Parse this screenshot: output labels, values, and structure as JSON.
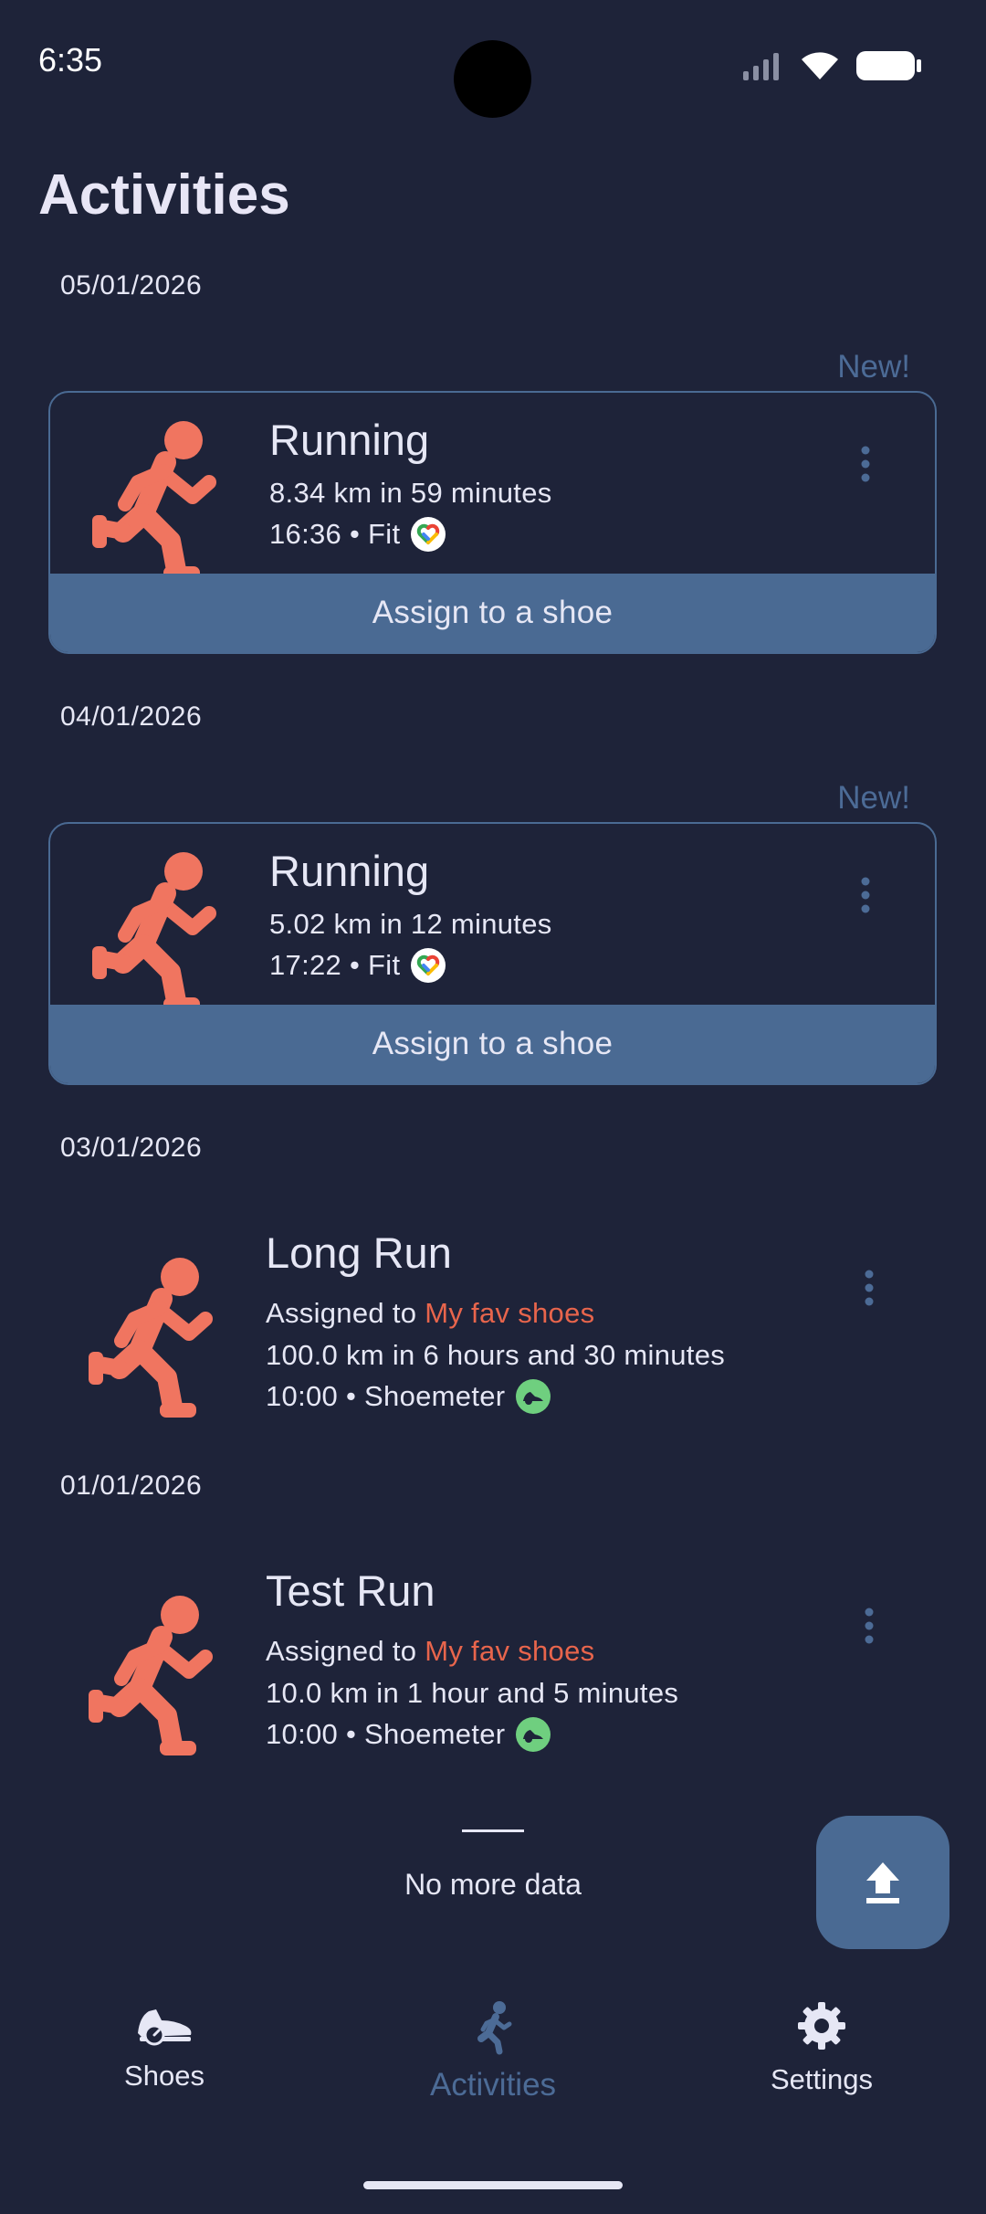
{
  "status": {
    "time": "6:35"
  },
  "page": {
    "title": "Activities"
  },
  "groups": [
    {
      "date": "05/01/2026",
      "new_label": "New!",
      "title": "Running",
      "summary": "8.34 km in 59 minutes",
      "meta": "16:36 • Fit",
      "source_icon": "google-fit-icon",
      "assign_label": "Assign to a shoe"
    },
    {
      "date": "04/01/2026",
      "new_label": "New!",
      "title": "Running",
      "summary": "5.02 km in 12 minutes",
      "meta": "17:22 • Fit",
      "source_icon": "google-fit-icon",
      "assign_label": "Assign to a shoe"
    },
    {
      "date": "03/01/2026",
      "title": "Long Run",
      "assigned_prefix": "Assigned to",
      "assigned_shoe": "My fav shoes",
      "summary": "100.0 km in 6 hours and 30 minutes",
      "meta": "10:00 • Shoemeter",
      "source_icon": "shoemeter-icon"
    },
    {
      "date": "01/01/2026",
      "title": "Test Run",
      "assigned_prefix": "Assigned to",
      "assigned_shoe": "My fav shoes",
      "summary": "10.0 km in 1 hour and 5 minutes",
      "meta": "10:00 • Shoemeter",
      "source_icon": "shoemeter-icon"
    }
  ],
  "footer": {
    "no_more": "No more data"
  },
  "nav": {
    "shoes": "Shoes",
    "activities": "Activities",
    "settings": "Settings",
    "active": "activities"
  },
  "colors": {
    "background": "#1e2339",
    "accent": "#4a6a93",
    "runner": "#f07560",
    "shoe_link": "#e8654c",
    "shoemeter_badge": "#6fcf7f"
  }
}
